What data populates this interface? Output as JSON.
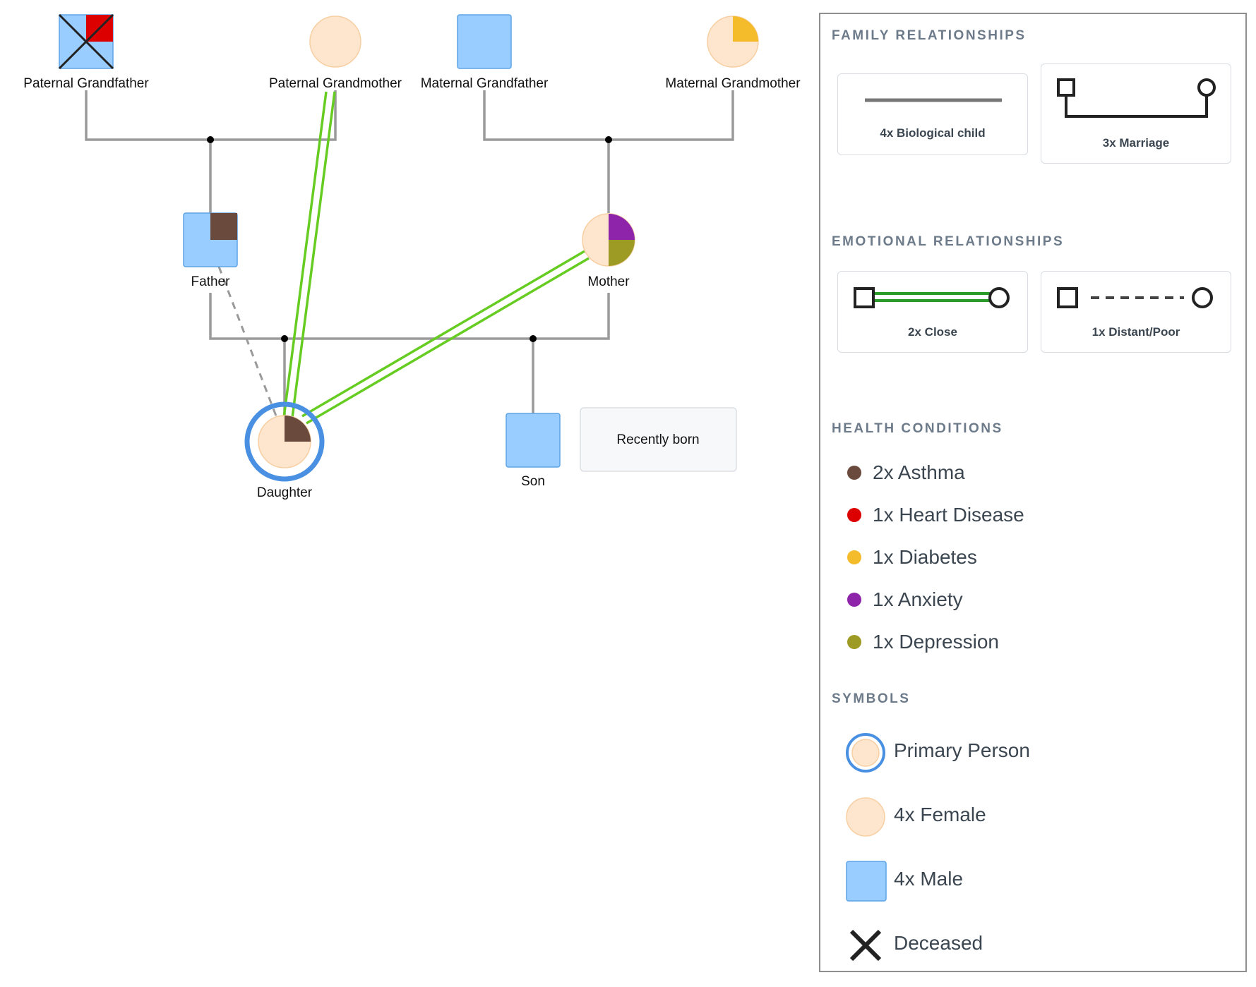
{
  "diagram": {
    "people": {
      "paternal_grandfather": "Paternal Grandfather",
      "paternal_grandmother": "Paternal Grandmother",
      "maternal_grandfather": "Maternal Grandfather",
      "maternal_grandmother": "Maternal Grandmother",
      "father": "Father",
      "mother": "Mother",
      "daughter": "Daughter",
      "son": "Son"
    },
    "note": "Recently born"
  },
  "legend": {
    "family_relationships": {
      "title": "FAMILY RELATIONSHIPS",
      "biological_child": "4x Biological child",
      "marriage": "3x Marriage"
    },
    "emotional_relationships": {
      "title": "EMOTIONAL RELATIONSHIPS",
      "close": "2x Close",
      "distant": "1x Distant/Poor"
    },
    "health_conditions": {
      "title": "HEALTH CONDITIONS",
      "items": [
        {
          "label": "2x Asthma",
          "color": "#6b4a3e"
        },
        {
          "label": "1x Heart Disease",
          "color": "#dd0000"
        },
        {
          "label": "1x Diabetes",
          "color": "#f4bb2a"
        },
        {
          "label": "1x Anxiety",
          "color": "#8e24aa"
        },
        {
          "label": "1x Depression",
          "color": "#9e9b24"
        }
      ]
    },
    "symbols": {
      "title": "SYMBOLS",
      "primary": "Primary Person",
      "female": "4x Female",
      "male": "4x Male",
      "deceased": "Deceased"
    }
  },
  "colors": {
    "male_fill": "#99ccff",
    "female_fill": "#fde6cd",
    "female_stroke": "#f7cfa3",
    "primary_ring": "#4a90e2",
    "close_line": "#66cc22",
    "family_line": "#999999"
  }
}
